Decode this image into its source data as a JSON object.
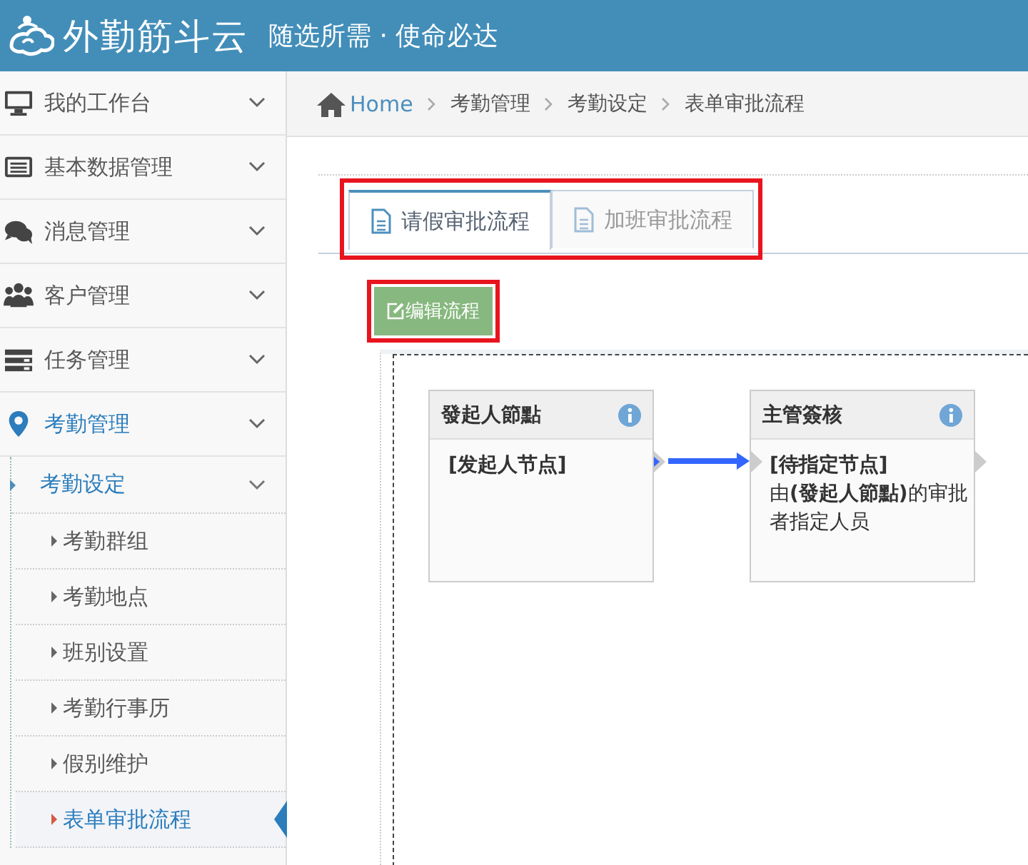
{
  "header": {
    "logo_text": "外勤筋斗云",
    "tagline": "随选所需 · 使命必达"
  },
  "sidebar": {
    "items": [
      {
        "label": "我的工作台",
        "expanded": false
      },
      {
        "label": "基本数据管理",
        "expanded": false
      },
      {
        "label": "消息管理",
        "expanded": false
      },
      {
        "label": "客户管理",
        "expanded": false
      },
      {
        "label": "任务管理",
        "expanded": false
      },
      {
        "label": "考勤管理",
        "expanded": true,
        "children": [
          {
            "label": "考勤设定",
            "expanded": true,
            "children": [
              {
                "label": "考勤群组",
                "selected": false
              },
              {
                "label": "考勤地点",
                "selected": false
              },
              {
                "label": "班别设置",
                "selected": false
              },
              {
                "label": "考勤行事历",
                "selected": false
              },
              {
                "label": "假别维护",
                "selected": false
              },
              {
                "label": "表单审批流程",
                "selected": true
              }
            ]
          }
        ]
      }
    ]
  },
  "breadcrumb": [
    "Home",
    "考勤管理",
    "考勤设定",
    "表单审批流程"
  ],
  "tabs_highlighted": true,
  "tabs": [
    {
      "label": "请假审批流程",
      "selected": true
    },
    {
      "label": "加班审批流程",
      "selected": false
    }
  ],
  "edit_button": {
    "label": "编辑流程",
    "highlighted": true
  },
  "flow": {
    "nodes": [
      {
        "title": "發起人節點",
        "body": [
          "[发起人节点]"
        ]
      },
      {
        "title": "主管簽核",
        "body": [
          "[待指定节点]",
          "由**(發起人節點)**的审批者指定人员"
        ]
      }
    ]
  }
}
